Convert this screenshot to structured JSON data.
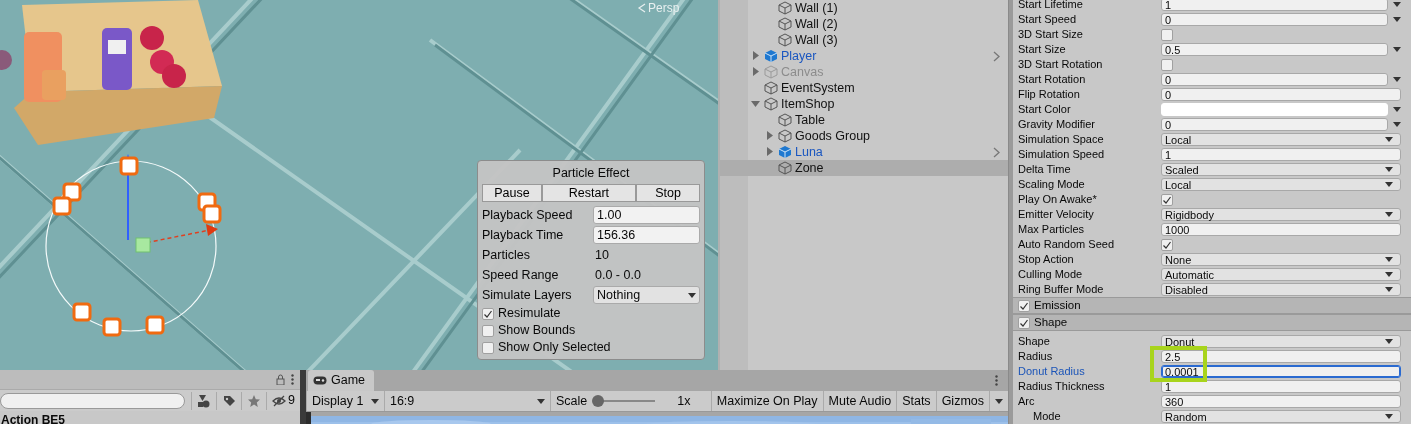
{
  "scene_view": {
    "camera_mode": "Persp"
  },
  "particle_effect": {
    "title": "Particle Effect",
    "buttons": [
      "Pause",
      "Restart",
      "Stop"
    ],
    "fields": [
      {
        "kind": "input",
        "label": "Playback Speed",
        "value": "1.00"
      },
      {
        "kind": "input",
        "label": "Playback Time",
        "value": "156.36"
      },
      {
        "kind": "readout",
        "label": "Particles",
        "value": "10"
      },
      {
        "kind": "readout",
        "label": "Speed Range",
        "value": "0.0 - 0.0"
      },
      {
        "kind": "dropdown",
        "label": "Simulate Layers",
        "value": "Nothing"
      }
    ],
    "options": [
      {
        "label": "Resimulate",
        "checked": true
      },
      {
        "label": "Show Bounds",
        "checked": false
      },
      {
        "label": "Show Only Selected",
        "checked": false
      }
    ]
  },
  "hierarchy": {
    "continued_children": [
      {
        "name": "Wall (1)",
        "selected": false
      },
      {
        "name": "Wall (2)",
        "selected": false
      },
      {
        "name": "Wall (3)",
        "selected": false
      }
    ],
    "items": [
      {
        "name": "Player",
        "kind": "prefab",
        "selected": false,
        "expanded": false
      },
      {
        "name": "Canvas",
        "kind": "inactive",
        "selected": false,
        "expanded": false
      },
      {
        "name": "EventSystem",
        "kind": "object",
        "selected": false
      },
      {
        "name": "ItemShop",
        "kind": "object",
        "selected": false,
        "expanded": true,
        "children": [
          {
            "name": "Table",
            "kind": "object",
            "selected": false
          },
          {
            "name": "Goods Group",
            "kind": "object",
            "selected": false,
            "expanded": false
          },
          {
            "name": "Luna",
            "kind": "prefab",
            "selected": false,
            "expanded": false
          },
          {
            "name": "Zone",
            "kind": "object",
            "selected": true
          }
        ]
      }
    ]
  },
  "inspector": {
    "rows": [
      {
        "kind": "curve",
        "label": "Start Lifetime",
        "value": "1"
      },
      {
        "kind": "curve",
        "label": "Start Speed",
        "value": "0"
      },
      {
        "kind": "checkbox",
        "label": "3D Start Size",
        "checked": false
      },
      {
        "kind": "curve",
        "label": "Start Size",
        "value": "0.5"
      },
      {
        "kind": "checkbox",
        "label": "3D Start Rotation",
        "checked": false
      },
      {
        "kind": "curve",
        "label": "Start Rotation",
        "value": "0"
      },
      {
        "kind": "text",
        "label": "Flip Rotation",
        "value": "0"
      },
      {
        "kind": "color",
        "label": "Start Color",
        "color": "#ffffff"
      },
      {
        "kind": "curve",
        "label": "Gravity Modifier",
        "value": "0"
      },
      {
        "kind": "dropdown",
        "label": "Simulation Space",
        "value": "Local"
      },
      {
        "kind": "text",
        "label": "Simulation Speed",
        "value": "1"
      },
      {
        "kind": "dropdown",
        "label": "Delta Time",
        "value": "Scaled"
      },
      {
        "kind": "dropdown",
        "label": "Scaling Mode",
        "value": "Local"
      },
      {
        "kind": "checkbox",
        "label": "Play On Awake*",
        "checked": true
      },
      {
        "kind": "dropdown",
        "label": "Emitter Velocity",
        "value": "Rigidbody"
      },
      {
        "kind": "text",
        "label": "Max Particles",
        "value": "1000"
      },
      {
        "kind": "checkbox",
        "label": "Auto Random Seed",
        "checked": true
      },
      {
        "kind": "dropdown",
        "label": "Stop Action",
        "value": "None"
      },
      {
        "kind": "dropdown",
        "label": "Culling Mode",
        "value": "Automatic"
      },
      {
        "kind": "dropdown",
        "label": "Ring Buffer Mode",
        "value": "Disabled"
      },
      {
        "kind": "section",
        "label": "Emission",
        "checked": true
      },
      {
        "kind": "section",
        "label": "Shape",
        "checked": true
      },
      {
        "kind": "dropdown",
        "label": "Shape",
        "value": "Donut"
      },
      {
        "kind": "text",
        "label": "Radius",
        "value": "2.5",
        "highlighted": true
      },
      {
        "kind": "text",
        "label": "Donut Radius",
        "value": "0.0001",
        "highlighted": true,
        "focused": true
      },
      {
        "kind": "text",
        "label": "Radius Thickness",
        "value": "1"
      },
      {
        "kind": "text",
        "label": "Arc",
        "value": "360",
        "children": [
          {
            "kind": "dropdown",
            "label": "Mode",
            "value": "Random"
          }
        ]
      }
    ]
  },
  "project_panel": {
    "hidden_count": "9",
    "entry": "Action BE5"
  },
  "game_view": {
    "tab": "Game",
    "display": "Display 1",
    "aspect": "16:9",
    "scale_label": "Scale",
    "scale": {
      "level": 0
    },
    "scale_reading": "1x",
    "toggles": [
      {
        "label": "Maximize On Play",
        "on": false
      },
      {
        "label": "Mute Audio",
        "on": false
      },
      {
        "label": "Stats",
        "on": false
      },
      {
        "label": "Gizmos",
        "on": false
      }
    ]
  }
}
